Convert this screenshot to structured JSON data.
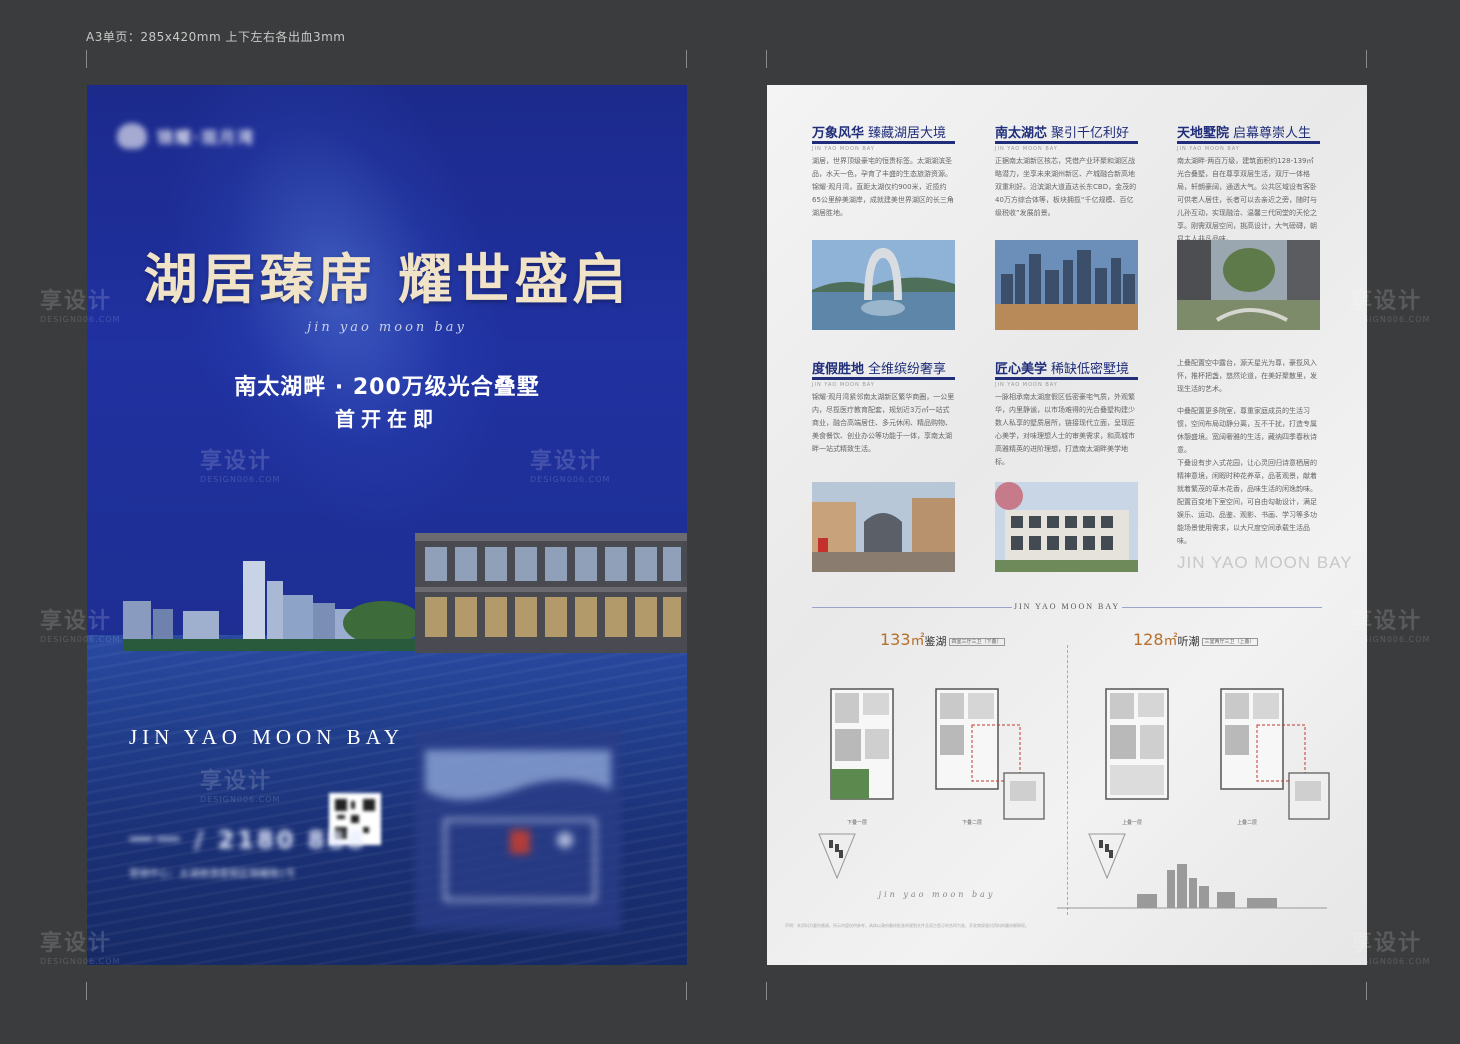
{
  "spec_note": "A3单页：285x420mm  上下左右各出血3mm",
  "front": {
    "logo_text": "锦耀·观月湾",
    "headline": "湖居臻席  耀世盛启",
    "script_line": "jin yao moon bay",
    "tagline": "南太湖畔 · 200万级光合叠墅",
    "tagline2": "首开在即",
    "brand_en": "JIN YAO  MOON BAY",
    "phone": "一一 / 2180 888",
    "address": "营销中心：太湖旅游度假区锦耀路1号"
  },
  "back": {
    "columns": [
      {
        "title": "万象风华",
        "subtitle": "臻藏湖居大境",
        "en": "JIN YAO MOON BAY",
        "text": "湖居，世界顶级豪宅的恒贵标签。太湖湖滨圣品，水天一色，孕育了丰盛的生态旅游资源。锦耀·观月湾，直距太湖仅约900米，近揽约65公里醉美湖岸，成就建美世界湖区的长三角湖居胜地。"
      },
      {
        "title": "南太湖芯",
        "subtitle": "聚引千亿利好",
        "en": "JIN YAO MOON BAY",
        "text": "正据南太湖新区核芯，凭借产业环聚和湖区战略潜力，坐享未来湖州新区、产城融合新高地双重利好。沿滨湖大道直达长东CBD，金茂的40万方综合体等，板块拥揽“千亿规模、百亿级税收”发展前景。"
      },
      {
        "title": "天地墅院",
        "subtitle": "启幕尊崇人生",
        "en": "JIN YAO MOON BAY",
        "text": "南太湖畔·两百万级，建筑面积约128-139㎡光合叠墅，自在尊享双层生活，双厅一体格局，轩朗豪阔，通透大气。公共区域设有客卧可供老人居住，长者可以去亲近之旁，随时与儿孙互动，实现融洽、温馨三代同堂的天伦之享。刚需双层空间，挑高设计，大气磅礴，朝显主人非凡品味。"
      },
      {
        "title": "度假胜地",
        "subtitle": "全维缤纷奢享",
        "en": "JIN YAO MOON BAY",
        "text": "锦耀·观月湾紧邻南太湖新区繁华商圈，一公里内，尽揽医疗教育配套，规划近3万㎡一站式商业，融合高端居住、多元休闲、精品购物、美食餐饮、创业办公等功能于一体，享南太湖畔一站式精致生活。"
      },
      {
        "title": "匠心美学",
        "subtitle": "稀缺低密墅境",
        "en": "JIN YAO MOON BAY",
        "text": "一脉相承南太湖度假区低密豪宅气质，外观繁华，内里静谧，以市场难得的光合叠墅构建少数人私享的墅质居所，链接现代立面，呈现匠心美学，对味理想人士的审美需求，和高城市高雅精英的进阶理想，打造南太湖畔美学地标。"
      }
    ],
    "right_text": [
      "上叠配置空中露台，源天星光为尊，豪揽风入怀，推杯把盏，悠然论道，在美好聚散里，发现生活的艺术。",
      "中叠配置更多院室，尊重家庭成员的生活习惯，空间布局动静分离，互不干扰，打造专属休憩盛境。宽阔奢雅的生活，藏纳四季春秋诗意。",
      "下叠设有步入式花园，让心灵回归诗意栖居的精神意境，闲暇时种花养草，品茗观景，献着就着繁茂的草木花香，品味生活的闲逸韵味。配置百变地下室空间，可自由勾勒设计，满足娱乐、运动、品鉴、观影、书画、学习等多功能场景使用需求，以大尺度空间承载生活品味。"
    ],
    "brand_ghost": "JIN YAO MOON BAY",
    "divider_title": "JIN YAO MOON BAY",
    "plans": [
      {
        "area": "133",
        "unit": "㎡",
        "name": "鉴湖",
        "tag": "四室三厅三卫（下叠）"
      },
      {
        "area": "128",
        "unit": "㎡",
        "name": "听潮",
        "tag": "三室两厅三卫（上叠）"
      }
    ],
    "plan_captions": [
      "下叠一层",
      "下叠二层",
      "上叠一层",
      "上叠二层"
    ],
    "script_line": "jin yao moon bay",
    "footnote": "声明：本资料为要约邀请，所示内容仅供参考，具体以政府最终批准的规划文件及双方签订的合同为准。开发商保留对资料的最终解释权。"
  },
  "watermark": {
    "cn": "享设计",
    "en": "DESIGN006.COM"
  }
}
